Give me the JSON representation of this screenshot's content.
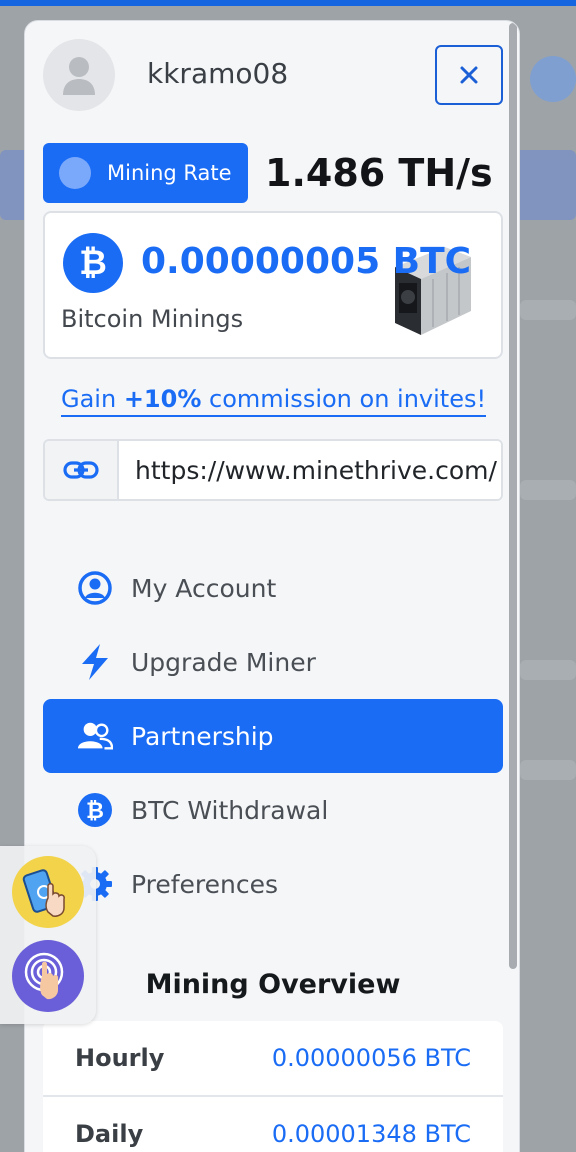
{
  "header": {
    "username": "kkramo08",
    "close_label": "×"
  },
  "mining_rate": {
    "label": "Mining Rate",
    "value": "1.486 TH/s"
  },
  "balance": {
    "amount": "0.00000005 BTC",
    "caption": "Bitcoin Minings",
    "badge_glyph": "₿"
  },
  "invite": {
    "prefix": "Gain ",
    "highlight": "+10%",
    "suffix": " commission on invites!"
  },
  "referral": {
    "url": "https://www.minethrive.com/"
  },
  "menu": {
    "items": [
      {
        "label": "My Account",
        "icon": "user-circle-icon"
      },
      {
        "label": "Upgrade Miner",
        "icon": "bolt-icon"
      },
      {
        "label": "Partnership",
        "icon": "handshake-users-icon",
        "active": true
      },
      {
        "label": "BTC Withdrawal",
        "icon": "bitcoin-icon"
      },
      {
        "label": "Preferences",
        "icon": "gear-icon"
      }
    ]
  },
  "overview": {
    "title": "Mining Overview",
    "rows": [
      {
        "key": "Hourly",
        "value": "0.00000056 BTC"
      },
      {
        "key": "Daily",
        "value": "0.00001348 BTC"
      }
    ]
  },
  "colors": {
    "accent": "#1a6cf5",
    "text_dark": "#16191c",
    "panel_bg": "#f5f6f8"
  }
}
